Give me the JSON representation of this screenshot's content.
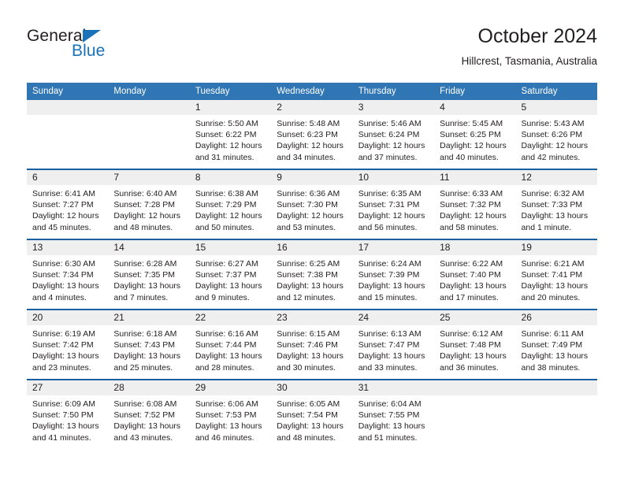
{
  "brand": {
    "name_part1": "General",
    "name_part2": "Blue",
    "accent_color": "#1a72b8"
  },
  "header": {
    "title": "October 2024",
    "subtitle": "Hillcrest, Tasmania, Australia",
    "header_bg_color": "#3176b4",
    "row_divider_color": "#1a5fa0",
    "daynum_bg_color": "#efefef"
  },
  "weekday_headers": [
    "Sunday",
    "Monday",
    "Tuesday",
    "Wednesday",
    "Thursday",
    "Friday",
    "Saturday"
  ],
  "weeks": [
    [
      {
        "day": "",
        "sunrise": "",
        "sunset": "",
        "daylight_line1": "",
        "daylight_line2": ""
      },
      {
        "day": "",
        "sunrise": "",
        "sunset": "",
        "daylight_line1": "",
        "daylight_line2": ""
      },
      {
        "day": "1",
        "sunrise": "Sunrise: 5:50 AM",
        "sunset": "Sunset: 6:22 PM",
        "daylight_line1": "Daylight: 12 hours",
        "daylight_line2": "and 31 minutes."
      },
      {
        "day": "2",
        "sunrise": "Sunrise: 5:48 AM",
        "sunset": "Sunset: 6:23 PM",
        "daylight_line1": "Daylight: 12 hours",
        "daylight_line2": "and 34 minutes."
      },
      {
        "day": "3",
        "sunrise": "Sunrise: 5:46 AM",
        "sunset": "Sunset: 6:24 PM",
        "daylight_line1": "Daylight: 12 hours",
        "daylight_line2": "and 37 minutes."
      },
      {
        "day": "4",
        "sunrise": "Sunrise: 5:45 AM",
        "sunset": "Sunset: 6:25 PM",
        "daylight_line1": "Daylight: 12 hours",
        "daylight_line2": "and 40 minutes."
      },
      {
        "day": "5",
        "sunrise": "Sunrise: 5:43 AM",
        "sunset": "Sunset: 6:26 PM",
        "daylight_line1": "Daylight: 12 hours",
        "daylight_line2": "and 42 minutes."
      }
    ],
    [
      {
        "day": "6",
        "sunrise": "Sunrise: 6:41 AM",
        "sunset": "Sunset: 7:27 PM",
        "daylight_line1": "Daylight: 12 hours",
        "daylight_line2": "and 45 minutes."
      },
      {
        "day": "7",
        "sunrise": "Sunrise: 6:40 AM",
        "sunset": "Sunset: 7:28 PM",
        "daylight_line1": "Daylight: 12 hours",
        "daylight_line2": "and 48 minutes."
      },
      {
        "day": "8",
        "sunrise": "Sunrise: 6:38 AM",
        "sunset": "Sunset: 7:29 PM",
        "daylight_line1": "Daylight: 12 hours",
        "daylight_line2": "and 50 minutes."
      },
      {
        "day": "9",
        "sunrise": "Sunrise: 6:36 AM",
        "sunset": "Sunset: 7:30 PM",
        "daylight_line1": "Daylight: 12 hours",
        "daylight_line2": "and 53 minutes."
      },
      {
        "day": "10",
        "sunrise": "Sunrise: 6:35 AM",
        "sunset": "Sunset: 7:31 PM",
        "daylight_line1": "Daylight: 12 hours",
        "daylight_line2": "and 56 minutes."
      },
      {
        "day": "11",
        "sunrise": "Sunrise: 6:33 AM",
        "sunset": "Sunset: 7:32 PM",
        "daylight_line1": "Daylight: 12 hours",
        "daylight_line2": "and 58 minutes."
      },
      {
        "day": "12",
        "sunrise": "Sunrise: 6:32 AM",
        "sunset": "Sunset: 7:33 PM",
        "daylight_line1": "Daylight: 13 hours",
        "daylight_line2": "and 1 minute."
      }
    ],
    [
      {
        "day": "13",
        "sunrise": "Sunrise: 6:30 AM",
        "sunset": "Sunset: 7:34 PM",
        "daylight_line1": "Daylight: 13 hours",
        "daylight_line2": "and 4 minutes."
      },
      {
        "day": "14",
        "sunrise": "Sunrise: 6:28 AM",
        "sunset": "Sunset: 7:35 PM",
        "daylight_line1": "Daylight: 13 hours",
        "daylight_line2": "and 7 minutes."
      },
      {
        "day": "15",
        "sunrise": "Sunrise: 6:27 AM",
        "sunset": "Sunset: 7:37 PM",
        "daylight_line1": "Daylight: 13 hours",
        "daylight_line2": "and 9 minutes."
      },
      {
        "day": "16",
        "sunrise": "Sunrise: 6:25 AM",
        "sunset": "Sunset: 7:38 PM",
        "daylight_line1": "Daylight: 13 hours",
        "daylight_line2": "and 12 minutes."
      },
      {
        "day": "17",
        "sunrise": "Sunrise: 6:24 AM",
        "sunset": "Sunset: 7:39 PM",
        "daylight_line1": "Daylight: 13 hours",
        "daylight_line2": "and 15 minutes."
      },
      {
        "day": "18",
        "sunrise": "Sunrise: 6:22 AM",
        "sunset": "Sunset: 7:40 PM",
        "daylight_line1": "Daylight: 13 hours",
        "daylight_line2": "and 17 minutes."
      },
      {
        "day": "19",
        "sunrise": "Sunrise: 6:21 AM",
        "sunset": "Sunset: 7:41 PM",
        "daylight_line1": "Daylight: 13 hours",
        "daylight_line2": "and 20 minutes."
      }
    ],
    [
      {
        "day": "20",
        "sunrise": "Sunrise: 6:19 AM",
        "sunset": "Sunset: 7:42 PM",
        "daylight_line1": "Daylight: 13 hours",
        "daylight_line2": "and 23 minutes."
      },
      {
        "day": "21",
        "sunrise": "Sunrise: 6:18 AM",
        "sunset": "Sunset: 7:43 PM",
        "daylight_line1": "Daylight: 13 hours",
        "daylight_line2": "and 25 minutes."
      },
      {
        "day": "22",
        "sunrise": "Sunrise: 6:16 AM",
        "sunset": "Sunset: 7:44 PM",
        "daylight_line1": "Daylight: 13 hours",
        "daylight_line2": "and 28 minutes."
      },
      {
        "day": "23",
        "sunrise": "Sunrise: 6:15 AM",
        "sunset": "Sunset: 7:46 PM",
        "daylight_line1": "Daylight: 13 hours",
        "daylight_line2": "and 30 minutes."
      },
      {
        "day": "24",
        "sunrise": "Sunrise: 6:13 AM",
        "sunset": "Sunset: 7:47 PM",
        "daylight_line1": "Daylight: 13 hours",
        "daylight_line2": "and 33 minutes."
      },
      {
        "day": "25",
        "sunrise": "Sunrise: 6:12 AM",
        "sunset": "Sunset: 7:48 PM",
        "daylight_line1": "Daylight: 13 hours",
        "daylight_line2": "and 36 minutes."
      },
      {
        "day": "26",
        "sunrise": "Sunrise: 6:11 AM",
        "sunset": "Sunset: 7:49 PM",
        "daylight_line1": "Daylight: 13 hours",
        "daylight_line2": "and 38 minutes."
      }
    ],
    [
      {
        "day": "27",
        "sunrise": "Sunrise: 6:09 AM",
        "sunset": "Sunset: 7:50 PM",
        "daylight_line1": "Daylight: 13 hours",
        "daylight_line2": "and 41 minutes."
      },
      {
        "day": "28",
        "sunrise": "Sunrise: 6:08 AM",
        "sunset": "Sunset: 7:52 PM",
        "daylight_line1": "Daylight: 13 hours",
        "daylight_line2": "and 43 minutes."
      },
      {
        "day": "29",
        "sunrise": "Sunrise: 6:06 AM",
        "sunset": "Sunset: 7:53 PM",
        "daylight_line1": "Daylight: 13 hours",
        "daylight_line2": "and 46 minutes."
      },
      {
        "day": "30",
        "sunrise": "Sunrise: 6:05 AM",
        "sunset": "Sunset: 7:54 PM",
        "daylight_line1": "Daylight: 13 hours",
        "daylight_line2": "and 48 minutes."
      },
      {
        "day": "31",
        "sunrise": "Sunrise: 6:04 AM",
        "sunset": "Sunset: 7:55 PM",
        "daylight_line1": "Daylight: 13 hours",
        "daylight_line2": "and 51 minutes."
      },
      {
        "day": "",
        "sunrise": "",
        "sunset": "",
        "daylight_line1": "",
        "daylight_line2": ""
      },
      {
        "day": "",
        "sunrise": "",
        "sunset": "",
        "daylight_line1": "",
        "daylight_line2": ""
      }
    ]
  ]
}
